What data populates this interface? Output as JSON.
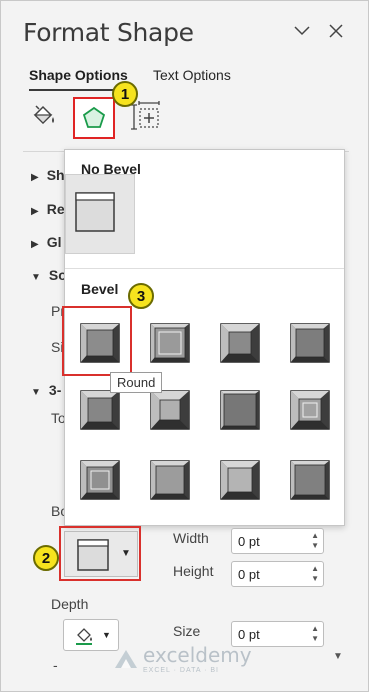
{
  "header": {
    "title": "Format Shape"
  },
  "tabs": [
    {
      "label": "Shape Options",
      "active": true
    },
    {
      "label": "Text Options",
      "active": false
    }
  ],
  "icon_tabs": [
    {
      "icon": "paint-bucket-icon"
    },
    {
      "icon": "pentagon-effects-icon",
      "selected": true
    },
    {
      "icon": "size-properties-icon"
    }
  ],
  "badges": [
    "1",
    "2",
    "3"
  ],
  "side_sections": [
    {
      "label": "Sh"
    },
    {
      "label": "Re"
    },
    {
      "label": "Gl"
    },
    {
      "label": "So"
    }
  ],
  "side_fields": [
    {
      "label": "Pr"
    },
    {
      "label": "Si"
    },
    {
      "label": "3-"
    },
    {
      "label": "To"
    },
    {
      "label": "Bo"
    }
  ],
  "popup": {
    "no_bevel_heading": "No Bevel",
    "bevel_heading": "Bevel",
    "tooltip": "Round"
  },
  "bottom_bevel": {
    "width_label": "Width",
    "width_value": "0 pt",
    "height_label": "Height",
    "height_value": "0 pt"
  },
  "depth": {
    "label": "Depth",
    "size_label": "Size",
    "size_value": "0 pt",
    "dash": "-"
  },
  "watermark": {
    "name": "exceldemy",
    "sub": "EXCEL · DATA · BI"
  },
  "colors": {
    "highlight": "#e02424",
    "badge": "#f6e31e",
    "accent_green": "#1a9b4a"
  }
}
